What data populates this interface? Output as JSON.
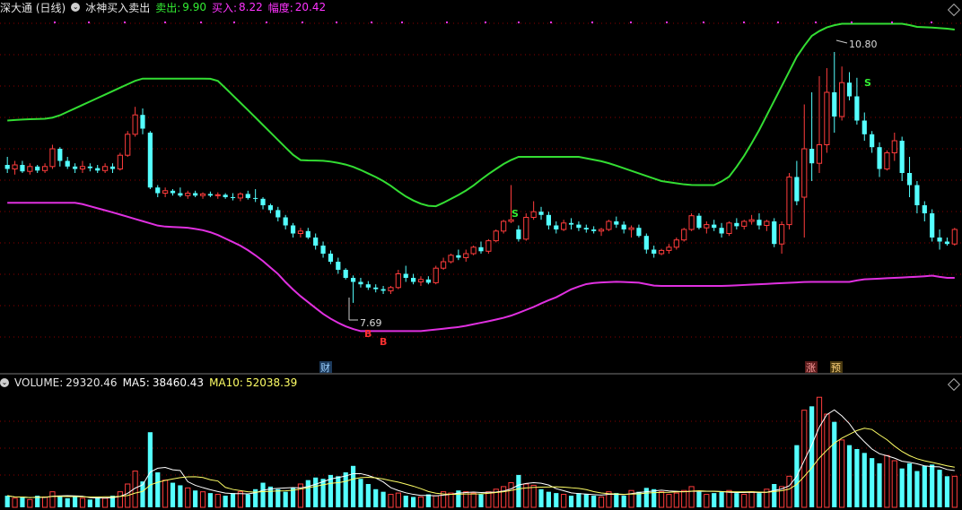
{
  "legend": {
    "security": "深大通 (日线)",
    "indicator": "冰神买入卖出",
    "sell_label": "卖出:",
    "sell_value": "9.90",
    "buy_label": "买入:",
    "buy_value": "8.22",
    "range_label": "幅度:",
    "range_value": "20.42"
  },
  "volume_legend": {
    "volume_label": "VOLUME:",
    "volume_value": "29320.46",
    "ma5_label": "MA5:",
    "ma5_value": "38460.43",
    "ma10_label": "MA10:",
    "ma10_value": "52038.39"
  },
  "annotations": {
    "low": "7.69",
    "high": "10.80",
    "buy_marker": "B",
    "sell_marker": "S",
    "event_cai": "财",
    "event_zhang": "涨",
    "event_yu": "预"
  },
  "colors": {
    "background": "#000000",
    "up": "#ff3c3c",
    "down": "#54ffff",
    "upper_band": "#33dd33",
    "lower_band": "#e030e0",
    "signal_bar": "#22ff22",
    "sell_text": "#33ee33",
    "buy_text": "#ff33ff",
    "ma5": "#ffffff",
    "ma10": "#ffff66",
    "grid": "#8b0000"
  },
  "chart_data": {
    "type": "candlestick",
    "price_range": [
      7.0,
      11.2
    ],
    "candles": [
      [
        9.4,
        9.5,
        9.3,
        9.35
      ],
      [
        9.35,
        9.45,
        9.28,
        9.4
      ],
      [
        9.4,
        9.45,
        9.3,
        9.32
      ],
      [
        9.32,
        9.42,
        9.28,
        9.38
      ],
      [
        9.38,
        9.4,
        9.3,
        9.33
      ],
      [
        9.33,
        9.42,
        9.3,
        9.38
      ],
      [
        9.38,
        9.65,
        9.35,
        9.6
      ],
      [
        9.6,
        9.62,
        9.38,
        9.45
      ],
      [
        9.45,
        9.5,
        9.35,
        9.38
      ],
      [
        9.38,
        9.42,
        9.3,
        9.35
      ],
      [
        9.35,
        9.45,
        9.3,
        9.38
      ],
      [
        9.38,
        9.42,
        9.32,
        9.36
      ],
      [
        9.36,
        9.4,
        9.3,
        9.33
      ],
      [
        9.33,
        9.42,
        9.3,
        9.38
      ],
      [
        9.38,
        9.42,
        9.3,
        9.35
      ],
      [
        9.35,
        9.55,
        9.33,
        9.52
      ],
      [
        9.52,
        9.82,
        9.5,
        9.78
      ],
      [
        9.78,
        10.12,
        9.75,
        10.02
      ],
      [
        10.02,
        10.1,
        9.78,
        9.85
      ],
      [
        9.8,
        9.82,
        9.1,
        9.12
      ],
      [
        9.12,
        9.15,
        9.0,
        9.05
      ],
      [
        9.05,
        9.12,
        9.0,
        9.08
      ],
      [
        9.08,
        9.1,
        9.02,
        9.05
      ],
      [
        9.05,
        9.12,
        9.0,
        9.02
      ],
      [
        9.02,
        9.08,
        8.98,
        9.05
      ],
      [
        9.05,
        9.08,
        9.0,
        9.02
      ],
      [
        9.02,
        9.06,
        8.98,
        9.04
      ],
      [
        9.04,
        9.07,
        9.0,
        9.02
      ],
      [
        9.02,
        9.06,
        8.98,
        9.03
      ],
      [
        9.03,
        9.05,
        8.98,
        9.0
      ],
      [
        9.0,
        9.05,
        8.96,
        8.99
      ],
      [
        8.99,
        9.06,
        8.95,
        9.04
      ],
      [
        9.04,
        9.08,
        8.97,
        8.99
      ],
      [
        8.99,
        9.1,
        8.94,
        8.98
      ],
      [
        8.98,
        9.0,
        8.85,
        8.9
      ],
      [
        8.9,
        8.92,
        8.8,
        8.84
      ],
      [
        8.84,
        8.88,
        8.7,
        8.75
      ],
      [
        8.75,
        8.78,
        8.6,
        8.65
      ],
      [
        8.65,
        8.68,
        8.5,
        8.55
      ],
      [
        8.55,
        8.62,
        8.5,
        8.58
      ],
      [
        8.58,
        8.62,
        8.48,
        8.5
      ],
      [
        8.5,
        8.55,
        8.35,
        8.4
      ],
      [
        8.4,
        8.45,
        8.25,
        8.3
      ],
      [
        8.3,
        8.34,
        8.17,
        8.2
      ],
      [
        8.2,
        8.25,
        8.05,
        8.1
      ],
      [
        8.1,
        8.12,
        7.98,
        8.0
      ],
      [
        8.0,
        8.03,
        7.69,
        7.95
      ],
      [
        7.95,
        8.0,
        7.88,
        7.92
      ],
      [
        7.92,
        7.96,
        7.85,
        7.88
      ],
      [
        7.88,
        7.92,
        7.82,
        7.86
      ],
      [
        7.86,
        7.9,
        7.8,
        7.84
      ],
      [
        7.84,
        7.9,
        7.8,
        7.88
      ],
      [
        7.88,
        8.1,
        7.86,
        8.05
      ],
      [
        8.05,
        8.15,
        7.95,
        8.0
      ],
      [
        8.0,
        8.05,
        7.92,
        7.95
      ],
      [
        7.95,
        8.02,
        7.9,
        7.98
      ],
      [
        7.98,
        8.02,
        7.92,
        7.94
      ],
      [
        7.94,
        8.15,
        7.92,
        8.12
      ],
      [
        8.12,
        8.25,
        8.1,
        8.2
      ],
      [
        8.2,
        8.3,
        8.18,
        8.28
      ],
      [
        8.28,
        8.35,
        8.22,
        8.25
      ],
      [
        8.25,
        8.35,
        8.2,
        8.3
      ],
      [
        8.3,
        8.4,
        8.28,
        8.38
      ],
      [
        8.38,
        8.45,
        8.3,
        8.33
      ],
      [
        8.33,
        8.48,
        8.3,
        8.46
      ],
      [
        8.46,
        8.6,
        8.44,
        8.58
      ],
      [
        8.58,
        8.72,
        8.55,
        8.7
      ],
      [
        8.7,
        9.15,
        8.68,
        8.72
      ],
      [
        8.6,
        8.65,
        8.45,
        8.48
      ],
      [
        8.48,
        8.8,
        8.46,
        8.75
      ],
      [
        8.75,
        8.95,
        8.72,
        8.82
      ],
      [
        8.82,
        8.88,
        8.72,
        8.78
      ],
      [
        8.78,
        8.82,
        8.6,
        8.65
      ],
      [
        8.65,
        8.7,
        8.55,
        8.6
      ],
      [
        8.6,
        8.72,
        8.58,
        8.68
      ],
      [
        8.68,
        8.74,
        8.6,
        8.66
      ],
      [
        8.66,
        8.7,
        8.58,
        8.62
      ],
      [
        8.62,
        8.66,
        8.56,
        8.6
      ],
      [
        8.6,
        8.64,
        8.55,
        8.58
      ],
      [
        8.58,
        8.62,
        8.52,
        8.6
      ],
      [
        8.6,
        8.72,
        8.58,
        8.7
      ],
      [
        8.7,
        8.76,
        8.62,
        8.66
      ],
      [
        8.66,
        8.7,
        8.55,
        8.6
      ],
      [
        8.6,
        8.65,
        8.5,
        8.62
      ],
      [
        8.62,
        8.66,
        8.5,
        8.52
      ],
      [
        8.52,
        8.55,
        8.3,
        8.35
      ],
      [
        8.35,
        8.4,
        8.25,
        8.3
      ],
      [
        8.3,
        8.36,
        8.28,
        8.34
      ],
      [
        8.34,
        8.42,
        8.3,
        8.38
      ],
      [
        8.38,
        8.5,
        8.35,
        8.47
      ],
      [
        8.47,
        8.62,
        8.45,
        8.6
      ],
      [
        8.6,
        8.8,
        8.58,
        8.77
      ],
      [
        8.77,
        8.8,
        8.6,
        8.62
      ],
      [
        8.62,
        8.7,
        8.55,
        8.66
      ],
      [
        8.66,
        8.72,
        8.58,
        8.62
      ],
      [
        8.62,
        8.68,
        8.5,
        8.55
      ],
      [
        8.55,
        8.7,
        8.52,
        8.68
      ],
      [
        8.68,
        8.74,
        8.6,
        8.64
      ],
      [
        8.64,
        8.72,
        8.6,
        8.7
      ],
      [
        8.7,
        8.78,
        8.66,
        8.72
      ],
      [
        8.72,
        8.8,
        8.6,
        8.65
      ],
      [
        8.65,
        8.72,
        8.58,
        8.7
      ],
      [
        8.7,
        8.74,
        8.38,
        8.42
      ],
      [
        8.42,
        8.7,
        8.3,
        8.66
      ],
      [
        8.66,
        9.3,
        8.6,
        9.25
      ],
      [
        9.25,
        9.45,
        8.9,
        8.95
      ],
      [
        9.0,
        10.15,
        8.5,
        9.6
      ],
      [
        9.6,
        10.3,
        9.2,
        9.42
      ],
      [
        9.42,
        10.5,
        9.3,
        9.65
      ],
      [
        9.65,
        10.6,
        9.55,
        10.3
      ],
      [
        10.3,
        10.8,
        9.8,
        10.0
      ],
      [
        10.0,
        10.62,
        9.95,
        10.42
      ],
      [
        10.42,
        10.55,
        10.2,
        10.25
      ],
      [
        10.25,
        10.48,
        9.9,
        9.95
      ],
      [
        9.95,
        10.05,
        9.7,
        9.78
      ],
      [
        9.78,
        9.82,
        9.55,
        9.62
      ],
      [
        9.62,
        9.68,
        9.25,
        9.35
      ],
      [
        9.35,
        9.58,
        9.33,
        9.55
      ],
      [
        9.55,
        9.8,
        9.45,
        9.7
      ],
      [
        9.7,
        9.75,
        9.2,
        9.3
      ],
      [
        9.3,
        9.5,
        9.0,
        9.15
      ],
      [
        9.15,
        9.2,
        8.8,
        8.9
      ],
      [
        8.9,
        8.95,
        8.7,
        8.8
      ],
      [
        8.8,
        8.85,
        8.45,
        8.5
      ],
      [
        8.5,
        8.6,
        8.35,
        8.45
      ],
      [
        8.45,
        8.5,
        8.4,
        8.42
      ],
      [
        8.42,
        8.62,
        8.4,
        8.6
      ]
    ],
    "volume": {
      "range": [
        0,
        90000
      ],
      "values": [
        9000,
        7000,
        8000,
        6000,
        9000,
        8000,
        12000,
        9000,
        7000,
        8000,
        7000,
        6000,
        8000,
        7000,
        9000,
        12000,
        18000,
        28000,
        20000,
        58000,
        27000,
        21000,
        19000,
        17000,
        15000,
        13000,
        12000,
        11000,
        10000,
        9000,
        11000,
        12000,
        10000,
        14000,
        19000,
        16000,
        14000,
        12000,
        15000,
        18000,
        21000,
        23000,
        22000,
        25000,
        24000,
        27000,
        32000,
        22000,
        18000,
        14000,
        12000,
        10000,
        11000,
        9000,
        8000,
        8000,
        10000,
        9000,
        12000,
        11000,
        13000,
        12000,
        11000,
        10000,
        12000,
        14000,
        16000,
        19000,
        25000,
        18000,
        17000,
        14000,
        12000,
        11000,
        10000,
        9000,
        11000,
        10000,
        9000,
        8000,
        12000,
        11000,
        9000,
        13000,
        12000,
        15000,
        14000,
        12000,
        10000,
        11000,
        13000,
        16000,
        12000,
        10000,
        11000,
        12000,
        13000,
        11000,
        10000,
        12000,
        11000,
        14000,
        18000,
        16000,
        24000,
        48000,
        75000,
        78000,
        85000,
        72000,
        66000,
        52000,
        48000,
        45000,
        42000,
        38000,
        34000,
        40000,
        36000,
        30000,
        34000,
        28000,
        32000,
        33000,
        29000,
        24000,
        24000
      ],
      "ma5": [],
      "ma10": []
    },
    "upper_band_label": "",
    "lower_band_label": ""
  }
}
